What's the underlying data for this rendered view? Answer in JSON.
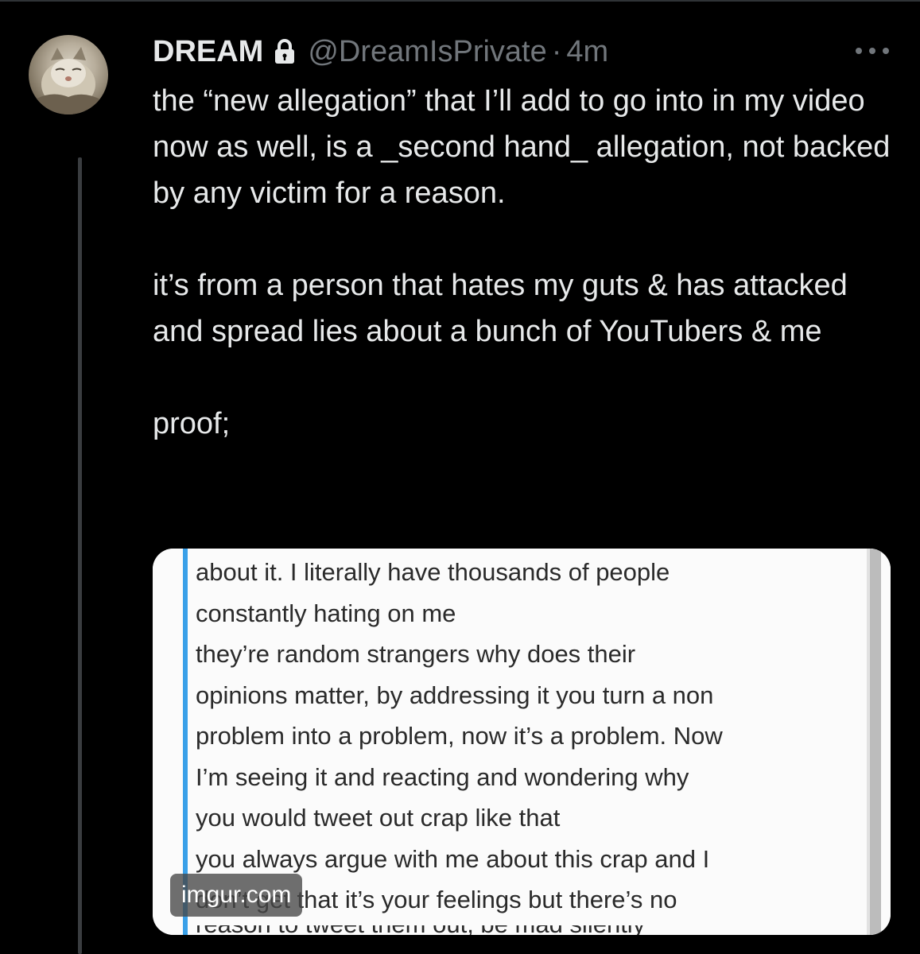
{
  "tweet": {
    "display_name": "DREAM",
    "handle": "@DreamIsPrivate",
    "separator": "·",
    "time": "4m",
    "paragraphs": [
      "the “new allegation” that I’ll add to go into in my video now as well, is a _second hand_ allegation, not backed by any victim for a reason.",
      "it’s from a person that hates my guts & has attacked and spread lies about a bunch of YouTubers & me",
      "proof;"
    ]
  },
  "media": {
    "lines": [
      "about it. I literally have thousands of people",
      "constantly hating on me",
      "they’re random strangers why does their",
      "opinions matter, by addressing it you turn a non",
      "problem into a problem, now it’s a problem. Now",
      "I’m seeing it and reacting and wondering why",
      "you would tweet out crap like that",
      "you always argue with me about this crap and I",
      "don’t get that it’s your feelings but there’s no"
    ],
    "cut_line": "reason to tweet them out, be mad silently",
    "watermark": "imgur.com"
  },
  "icons": {
    "lock": "lock-icon",
    "more": "more-icon"
  },
  "colors": {
    "background": "#000000",
    "text": "#e7e9ea",
    "secondary": "#71767b",
    "quote_bar": "#3aa0e8"
  }
}
